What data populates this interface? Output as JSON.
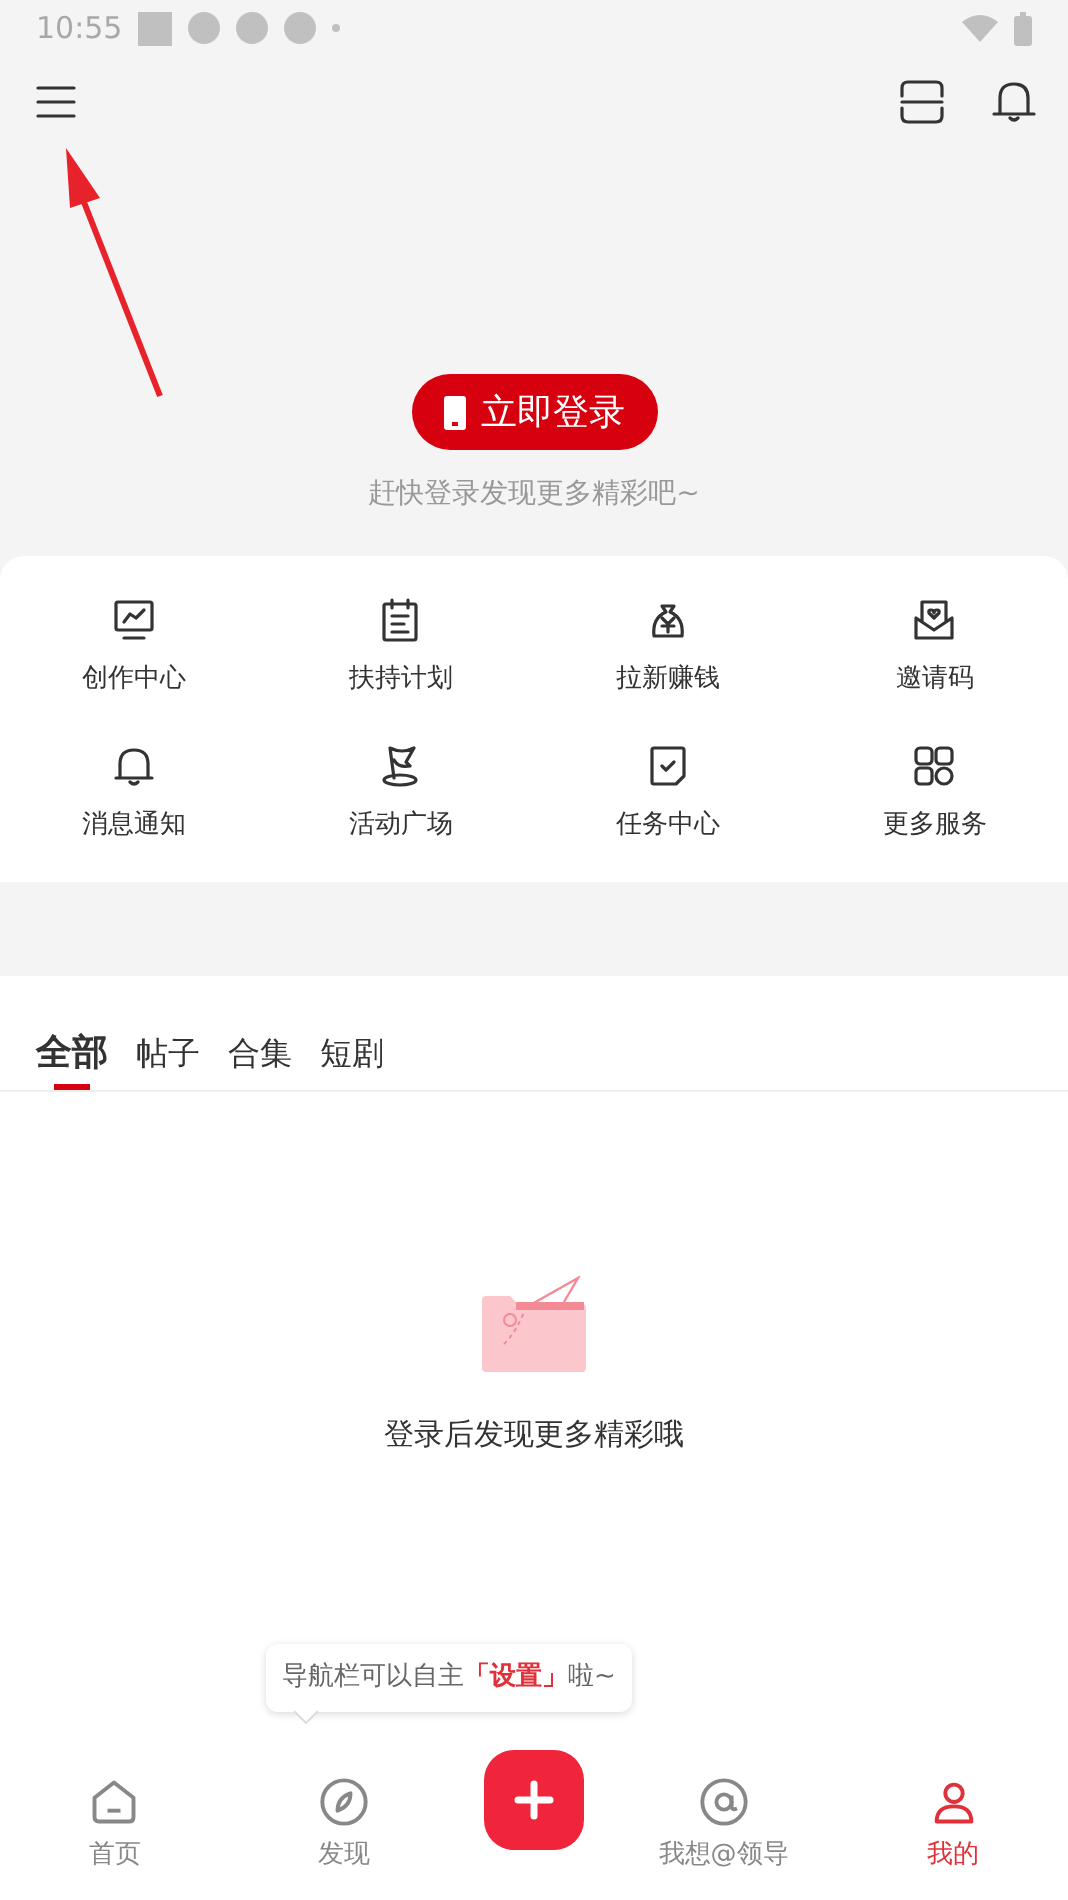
{
  "status_bar": {
    "time": "10:55"
  },
  "login": {
    "button": "立即登录",
    "hint": "赶快登录发现更多精彩吧~"
  },
  "services": [
    {
      "label": "创作中心"
    },
    {
      "label": "扶持计划"
    },
    {
      "label": "拉新赚钱"
    },
    {
      "label": "邀请码"
    },
    {
      "label": "消息通知"
    },
    {
      "label": "活动广场"
    },
    {
      "label": "任务中心"
    },
    {
      "label": "更多服务"
    }
  ],
  "tabs": [
    {
      "label": "全部",
      "selected": true
    },
    {
      "label": "帖子",
      "selected": false
    },
    {
      "label": "合集",
      "selected": false
    },
    {
      "label": "短剧",
      "selected": false
    }
  ],
  "empty_state": {
    "message": "登录后发现更多精彩哦"
  },
  "tooltip": {
    "text": "导航栏可以自主**「设置」**啦~"
  },
  "bottom_nav": [
    {
      "label": "首页",
      "selected": false
    },
    {
      "label": "发现",
      "selected": false
    },
    {
      "kind": "add"
    },
    {
      "label": "我想@领导",
      "selected": false
    },
    {
      "label": "我的",
      "selected": true
    }
  ]
}
